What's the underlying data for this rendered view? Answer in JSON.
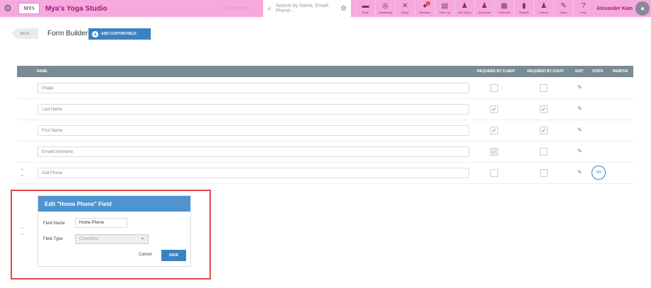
{
  "topbar": {
    "studio_name": "Mya's Yoga Studio",
    "logo_text": "MYS",
    "uid_placeholder": "UID search",
    "search_placeholder": "Search by Name, Email, Phone...",
    "user_name": "Alexander Kam",
    "nav": [
      {
        "label": "Store",
        "icon": "store-icon"
      },
      {
        "label": "Dashboard",
        "icon": "dashboard-icon"
      },
      {
        "label": "Setup",
        "icon": "tools-icon"
      },
      {
        "label": "Reviews",
        "icon": "chat-icon",
        "badge": "0"
      },
      {
        "label": "Edit Log",
        "icon": "edit-log-icon"
      },
      {
        "label": "Add Client",
        "icon": "add-client-icon"
      },
      {
        "label": "Add Lead",
        "icon": "add-lead-icon"
      },
      {
        "label": "Schedule",
        "icon": "calendar-icon"
      },
      {
        "label": "Reports",
        "icon": "chart-icon"
      },
      {
        "label": "Clients",
        "icon": "clients-icon"
      },
      {
        "label": "Tasks",
        "icon": "tasks-icon"
      },
      {
        "label": "Help",
        "icon": "help-icon"
      }
    ]
  },
  "header": {
    "back_label": "BACK",
    "title": "Form Builder",
    "add_field_label": "ADD CUSTOM FIELD"
  },
  "table": {
    "columns": {
      "name": "NAME",
      "required_client": "REQUIRED BY CLIENT",
      "required_staff": "REQUIRED BY STAFF",
      "edit": "EDIT",
      "state": "STATE",
      "remove": "REMOVE"
    },
    "rows": [
      {
        "name": "Image",
        "req_client": false,
        "req_staff": false,
        "client_disabled": false,
        "state": ""
      },
      {
        "name": "Last Name",
        "req_client": true,
        "req_staff": true,
        "client_disabled": false,
        "state": ""
      },
      {
        "name": "First Name",
        "req_client": true,
        "req_staff": true,
        "client_disabled": false,
        "state": ""
      },
      {
        "name": "Email/Username",
        "req_client": true,
        "req_staff": false,
        "client_disabled": true,
        "state": ""
      },
      {
        "name": "Cell Phone",
        "req_client": false,
        "req_staff": false,
        "client_disabled": false,
        "state": "ON"
      }
    ]
  },
  "edit_panel": {
    "title": "Edit \"Home Phone\" Field",
    "field_name_label": "Field Name",
    "field_name_value": "Home Phone",
    "field_type_label": "Field Type",
    "field_type_value": "Checkbox",
    "cancel_label": "Cancel",
    "save_label": "SAVE"
  },
  "colors": {
    "topbar": "#f6a9dc",
    "accent": "#3b82c4",
    "table_header": "#7b8b93",
    "highlight": "#e04848"
  }
}
